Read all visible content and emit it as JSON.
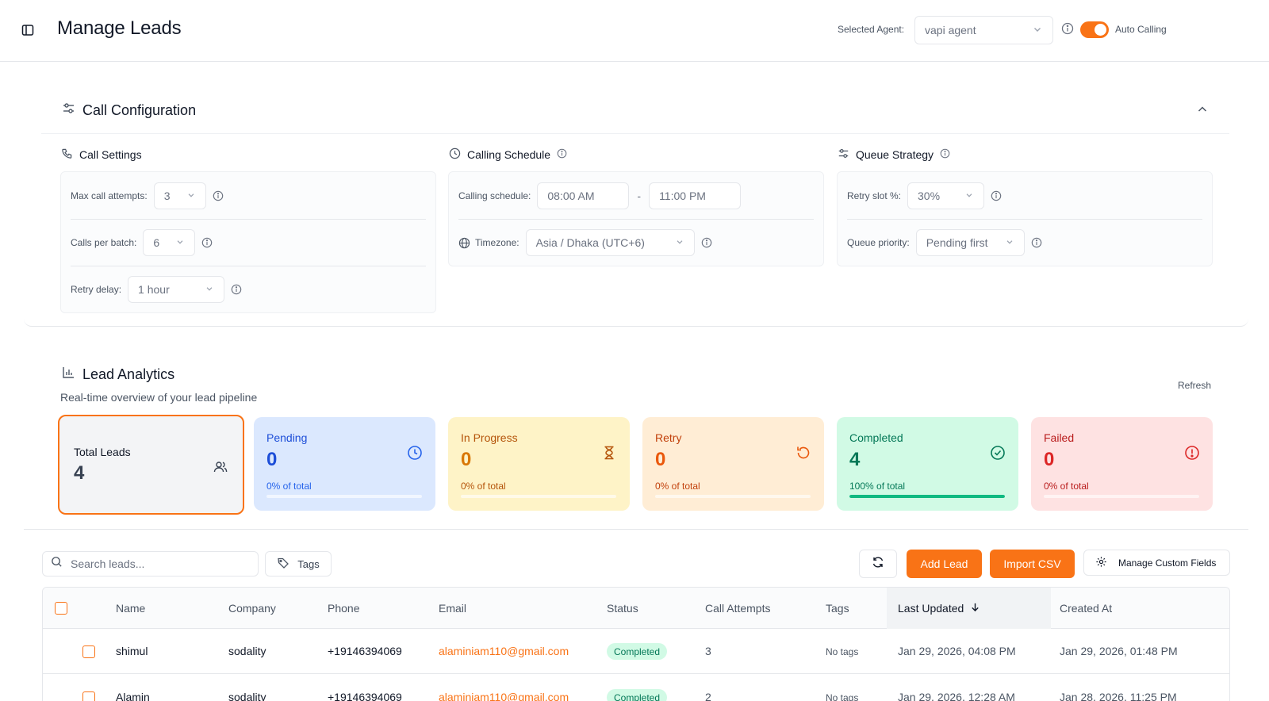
{
  "header": {
    "title": "Manage Leads",
    "agent_label": "Selected Agent:",
    "agent_value": "vapi agent",
    "auto_calling_label": "Auto Calling",
    "auto_calling_on": true
  },
  "config": {
    "title": "Call Configuration",
    "call_settings": {
      "title": "Call Settings",
      "max_attempts_label": "Max call attempts:",
      "max_attempts_value": "3",
      "calls_per_batch_label": "Calls per batch:",
      "calls_per_batch_value": "6",
      "retry_delay_label": "Retry delay:",
      "retry_delay_value": "1 hour"
    },
    "calling_schedule": {
      "title": "Calling Schedule",
      "schedule_label": "Calling schedule:",
      "start": "08:00 AM",
      "separator": "-",
      "end": "11:00 PM",
      "timezone_label": "Timezone:",
      "timezone_value": "Asia / Dhaka (UTC+6)"
    },
    "queue_strategy": {
      "title": "Queue Strategy",
      "retry_slot_label": "Retry slot %:",
      "retry_slot_value": "30%",
      "priority_label": "Queue priority:",
      "priority_value": "Pending first"
    }
  },
  "analytics": {
    "title": "Lead Analytics",
    "subtitle": "Real-time overview of your lead pipeline",
    "refresh_label": "Refresh",
    "total": {
      "label": "Total Leads",
      "value": "4"
    },
    "cards": [
      {
        "label": "Pending",
        "value": "0",
        "pct_text": "0% of total",
        "fraction": 0,
        "color": "#1d4ed8"
      },
      {
        "label": "In Progress",
        "value": "0",
        "pct_text": "0% of total",
        "fraction": 0,
        "color": "#d97706"
      },
      {
        "label": "Retry",
        "value": "0",
        "pct_text": "0% of total",
        "fraction": 0,
        "color": "#ea580c"
      },
      {
        "label": "Completed",
        "value": "4",
        "pct_text": "100% of total",
        "fraction": 1,
        "color": "#10b981"
      },
      {
        "label": "Failed",
        "value": "0",
        "pct_text": "0% of total",
        "fraction": 0,
        "color": "#dc2626"
      }
    ]
  },
  "toolbar": {
    "search_placeholder": "Search leads...",
    "tags_label": "Tags",
    "add_lead_label": "Add Lead",
    "import_csv_label": "Import CSV",
    "custom_fields_label": "Manage Custom Fields"
  },
  "table": {
    "columns": [
      "Name",
      "Company",
      "Phone",
      "Email",
      "Status",
      "Call Attempts",
      "Tags",
      "Last Updated",
      "Created At"
    ],
    "rows": [
      {
        "name": "shimul",
        "company": "sodality",
        "phone": "+19146394069",
        "email": "alaminiam110@gmail.com",
        "status": "Completed",
        "attempts": "3",
        "tags": "No tags",
        "updated": "Jan 29, 2026, 04:08 PM",
        "created": "Jan 29, 2026, 01:48 PM"
      },
      {
        "name": "Alamin",
        "company": "sodality",
        "phone": "+19146394069",
        "email": "alaminiam110@gmail.com",
        "status": "Completed",
        "attempts": "2",
        "tags": "No tags",
        "updated": "Jan 29, 2026, 12:28 AM",
        "created": "Jan 28, 2026, 11:25 PM"
      }
    ]
  },
  "colors": {
    "accent": "#f97316"
  }
}
